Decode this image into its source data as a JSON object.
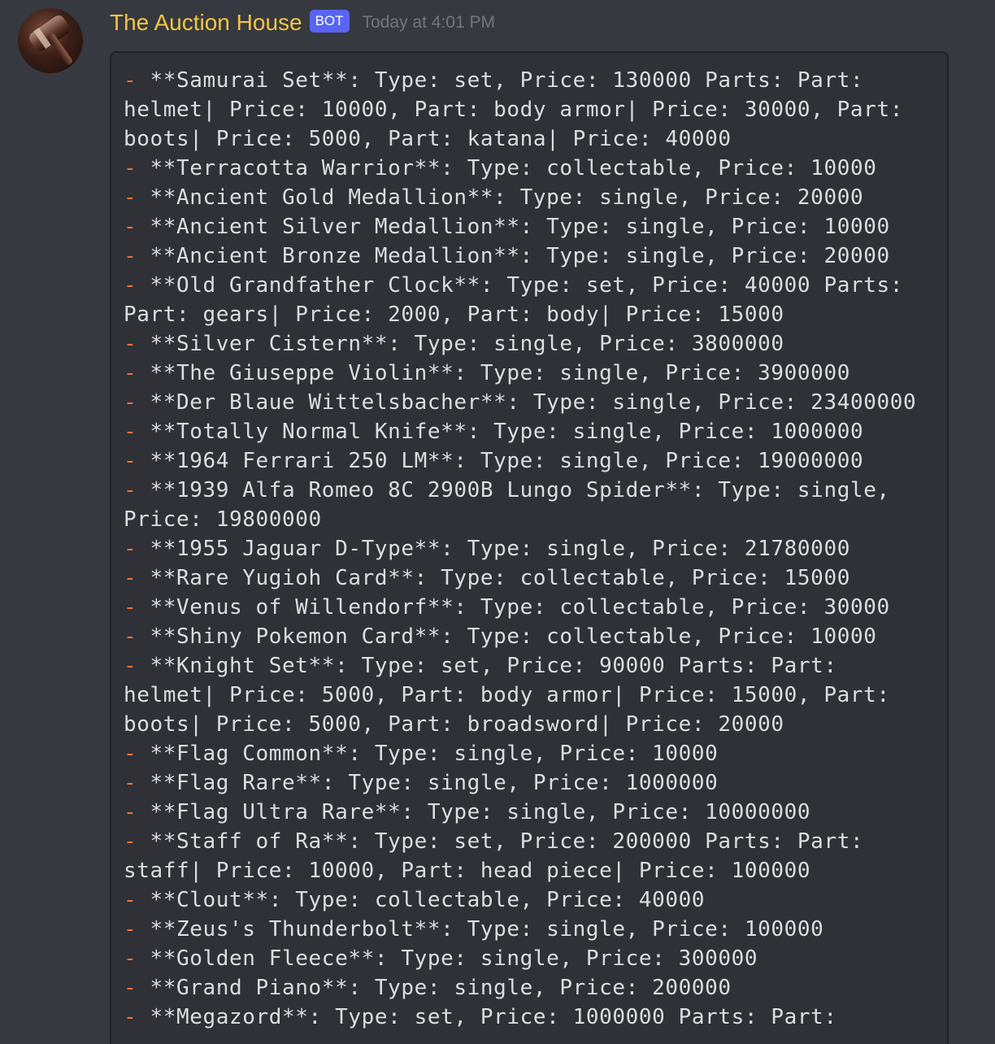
{
  "author": {
    "name": "The Auction House",
    "tag": "BOT",
    "timestamp": "Today at 4:01 PM",
    "avatar": "gavel-icon"
  },
  "colors": {
    "username": "#f5c542",
    "bot_tag": "#5865f2",
    "dash": "#e8743b",
    "code_text": "#dcddde",
    "code_bg": "#2f3136",
    "background": "#36393f"
  },
  "items": [
    {
      "dash": "-",
      "text": " **Samurai Set**: Type: set, Price: 130000 Parts: Part: helmet| Price: 10000, Part: body armor| Price: 30000, Part: boots| Price: 5000, Part: katana| Price: 40000"
    },
    {
      "dash": "-",
      "text": " **Terracotta Warrior**: Type: collectable, Price: 10000"
    },
    {
      "dash": "-",
      "text": " **Ancient Gold Medallion**: Type: single, Price: 20000"
    },
    {
      "dash": "-",
      "text": " **Ancient Silver Medallion**: Type: single, Price: 10000"
    },
    {
      "dash": "-",
      "text": " **Ancient Bronze Medallion**: Type: single, Price: 20000"
    },
    {
      "dash": "-",
      "text": " **Old Grandfather Clock**: Type: set, Price: 40000 Parts: Part: gears| Price: 2000, Part: body| Price: 15000"
    },
    {
      "dash": "-",
      "text": " **Silver Cistern**: Type: single, Price: 3800000"
    },
    {
      "dash": "-",
      "text": " **The Giuseppe Violin**: Type: single, Price: 3900000"
    },
    {
      "dash": "-",
      "text": " **Der Blaue Wittelsbacher**: Type: single, Price: 23400000"
    },
    {
      "dash": "-",
      "text": " **Totally Normal Knife**: Type: single, Price: 1000000"
    },
    {
      "dash": "-",
      "text": " **1964 Ferrari 250 LM**: Type: single, Price: 19000000"
    },
    {
      "dash": "-",
      "text": " **1939 Alfa Romeo 8C 2900B Lungo Spider**: Type: single, Price: 19800000"
    },
    {
      "dash": "-",
      "text": " **1955 Jaguar D-Type**: Type: single, Price: 21780000"
    },
    {
      "dash": "-",
      "text": " **Rare Yugioh Card**: Type: collectable, Price: 15000"
    },
    {
      "dash": "-",
      "text": " **Venus of Willendorf**: Type: collectable, Price: 30000"
    },
    {
      "dash": "-",
      "text": " **Shiny Pokemon Card**: Type: collectable, Price: 10000"
    },
    {
      "dash": "-",
      "text": " **Knight Set**: Type: set, Price: 90000 Parts: Part: helmet| Price: 5000, Part: body armor| Price: 15000, Part: boots| Price: 5000, Part: broadsword| Price: 20000"
    },
    {
      "dash": "-",
      "text": " **Flag Common**: Type: single, Price: 10000"
    },
    {
      "dash": "-",
      "text": " **Flag Rare**: Type: single, Price: 1000000"
    },
    {
      "dash": "-",
      "text": " **Flag Ultra Rare**: Type: single, Price: 10000000"
    },
    {
      "dash": "-",
      "text": " **Staff of Ra**: Type: set, Price: 200000 Parts: Part: staff| Price: 10000, Part: head piece| Price: 100000"
    },
    {
      "dash": "-",
      "text": " **Clout**: Type: collectable, Price: 40000"
    },
    {
      "dash": "-",
      "text": " **Zeus's Thunderbolt**: Type: single, Price: 100000"
    },
    {
      "dash": "-",
      "text": " **Golden Fleece**: Type: single, Price: 300000"
    },
    {
      "dash": "-",
      "text": " **Grand Piano**: Type: single, Price: 200000"
    },
    {
      "dash": "-",
      "text": " **Megazord**: Type: set, Price: 1000000 Parts: Part:"
    }
  ]
}
